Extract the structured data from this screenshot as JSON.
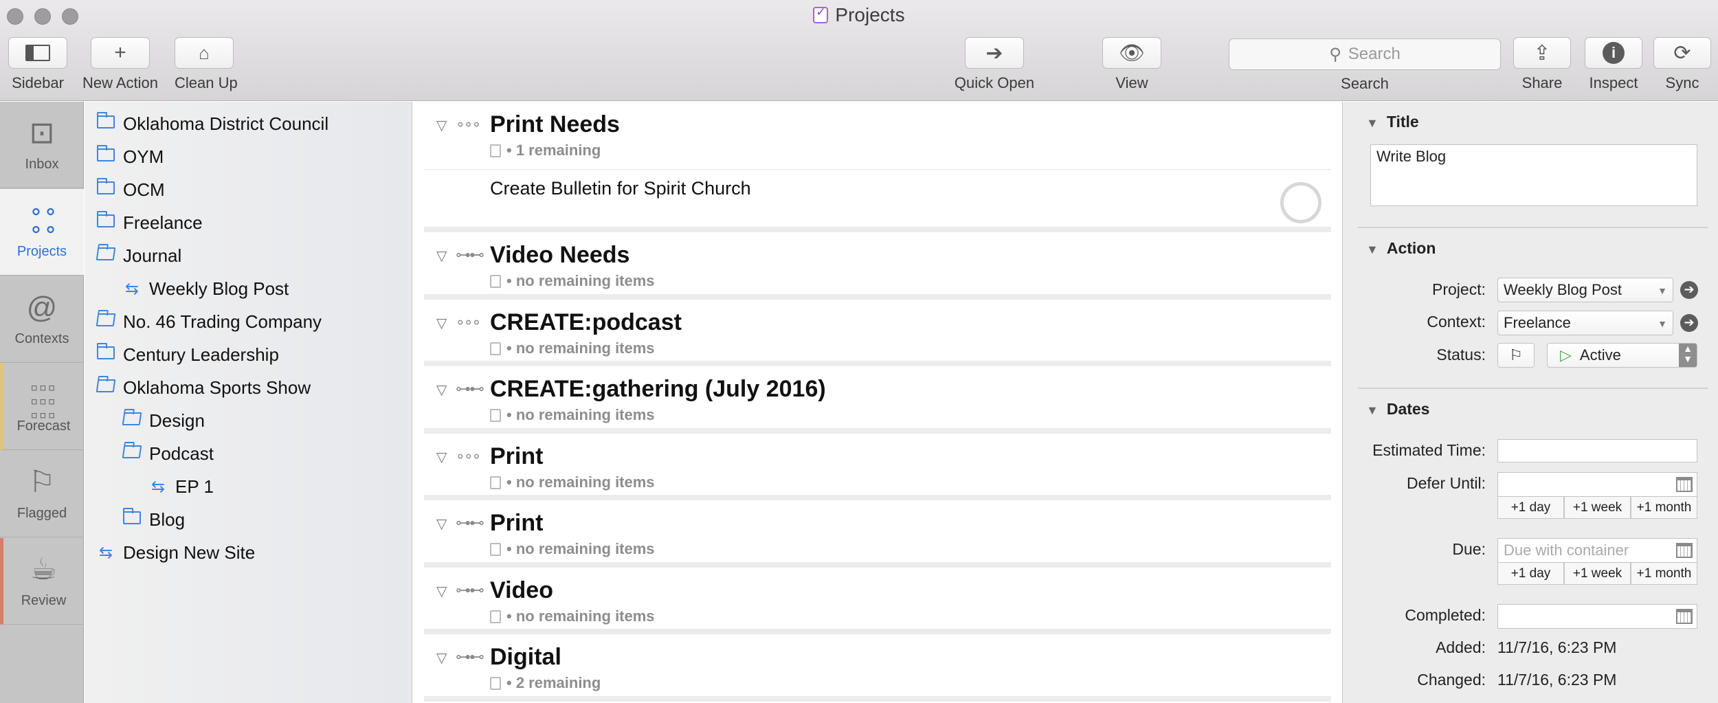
{
  "window": {
    "title": "Projects"
  },
  "toolbar": {
    "sidebar_label": "Sidebar",
    "new_action_label": "New Action",
    "clean_up_label": "Clean Up",
    "quick_open_label": "Quick Open",
    "view_label": "View",
    "search_placeholder": "Search",
    "search_label": "Search",
    "share_label": "Share",
    "inspect_label": "Inspect",
    "sync_label": "Sync"
  },
  "perspectives": {
    "inbox": "Inbox",
    "projects": "Projects",
    "contexts": "Contexts",
    "forecast": "Forecast",
    "flagged": "Flagged",
    "review": "Review"
  },
  "sidebar": {
    "items": [
      {
        "label": "Oklahoma District Council",
        "icon": "folder-icon"
      },
      {
        "label": "OYM",
        "icon": "folder-icon"
      },
      {
        "label": "OCM",
        "icon": "folder-icon"
      },
      {
        "label": "Freelance",
        "icon": "folder-icon"
      },
      {
        "label": "Journal",
        "icon": "open-folder-icon"
      },
      {
        "label": "Weekly Blog Post",
        "icon": "sequential-project-icon"
      },
      {
        "label": "No. 46 Trading Company",
        "icon": "open-folder-icon"
      },
      {
        "label": "Century Leadership",
        "icon": "folder-icon"
      },
      {
        "label": "Oklahoma Sports Show",
        "icon": "open-folder-icon"
      },
      {
        "label": "Design",
        "icon": "open-folder-icon"
      },
      {
        "label": "Podcast",
        "icon": "open-folder-icon"
      },
      {
        "label": "EP 1",
        "icon": "sequential-project-icon"
      },
      {
        "label": "Blog",
        "icon": "folder-icon"
      },
      {
        "label": "Design New Site",
        "icon": "sequential-project-icon"
      }
    ]
  },
  "outline": {
    "projects": [
      {
        "title": "Print Needs",
        "remaining": "1 remaining"
      },
      {
        "title": "Video Needs",
        "remaining": "no remaining items"
      },
      {
        "title": "CREATE:podcast",
        "remaining": "no remaining items"
      },
      {
        "title": "CREATE:gathering (July 2016)",
        "remaining": "no remaining items"
      },
      {
        "title": "Print",
        "remaining": "no remaining items"
      },
      {
        "title": "Print",
        "remaining": "no remaining items"
      },
      {
        "title": "Video",
        "remaining": "no remaining items"
      },
      {
        "title": "Digital",
        "remaining": "2 remaining"
      }
    ],
    "action": {
      "title": "Create Bulletin for Spirit Church"
    }
  },
  "inspector": {
    "title_heading": "Title",
    "title_value": "Write Blog",
    "action_heading": "Action",
    "project_label": "Project:",
    "project_value": "Weekly Blog Post",
    "context_label": "Context:",
    "context_value": "Freelance",
    "status_label": "Status:",
    "status_value": "Active",
    "dates_heading": "Dates",
    "estimated_label": "Estimated Time:",
    "defer_label": "Defer Until:",
    "due_label": "Due:",
    "due_placeholder": "Due with container",
    "quick_day": "+1 day",
    "quick_week": "+1 week",
    "quick_month": "+1 month",
    "completed_label": "Completed:",
    "added_label": "Added:",
    "added_value": "11/7/16, 6:23 PM",
    "changed_label": "Changed:",
    "changed_value": "11/7/16, 6:23 PM"
  },
  "colors": {
    "accent": "#3c86e0",
    "projects_purple": "#a166d6",
    "status_green": "#4caf50"
  }
}
